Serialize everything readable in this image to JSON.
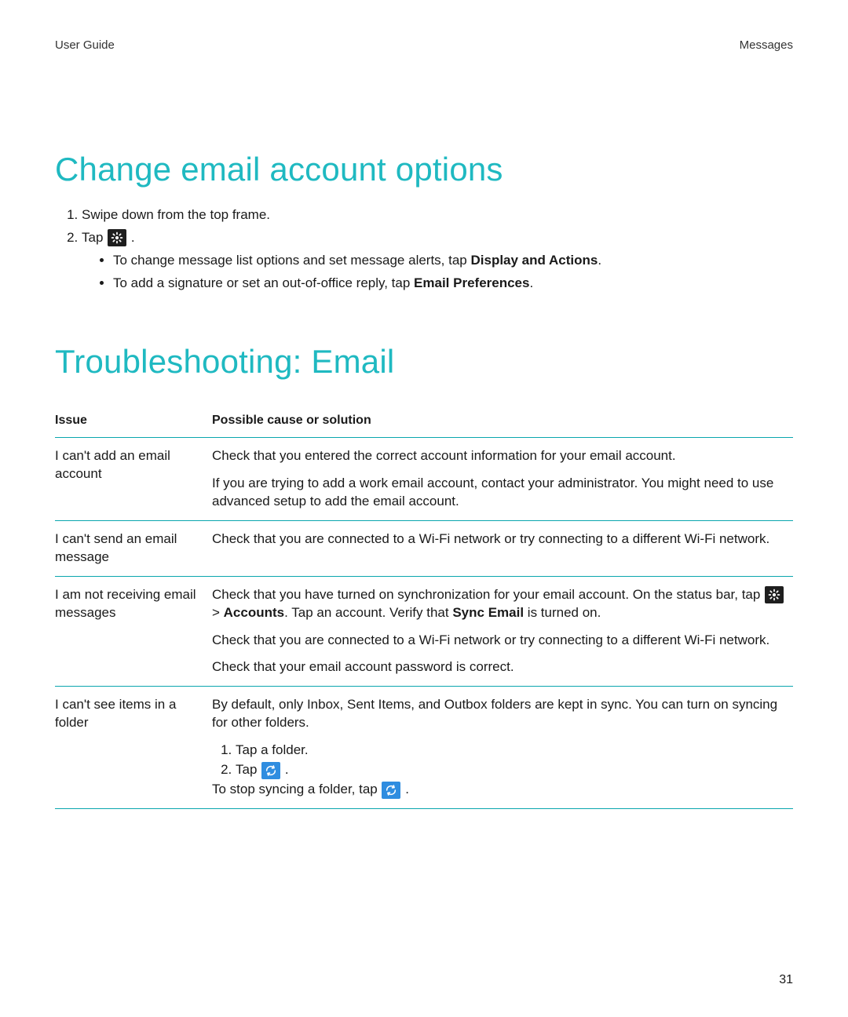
{
  "header": {
    "left": "User Guide",
    "right": "Messages"
  },
  "section1": {
    "title": "Change email account options",
    "steps": {
      "s1": "Swipe down from the top frame.",
      "s2_prefix": "Tap ",
      "s2_suffix": " .",
      "bullets": {
        "b1_pre": "To change message list options and set message alerts, tap ",
        "b1_bold": "Display and Actions",
        "b1_post": ".",
        "b2_pre": "To add a signature or set an out-of-office reply, tap ",
        "b2_bold": "Email Preferences",
        "b2_post": "."
      }
    }
  },
  "section2": {
    "title": "Troubleshooting: Email",
    "col_issue": "Issue",
    "col_solution": "Possible cause or solution",
    "rows": {
      "r1": {
        "issue": "I can't add an email account",
        "p1": "Check that you entered the correct account information for your email account.",
        "p2": "If you are trying to add a work email account, contact your administrator. You might need to use advanced setup to add the email account."
      },
      "r2": {
        "issue": "I can't send an email message",
        "p1": "Check that you are connected to a Wi-Fi network or try connecting to a different Wi-Fi network."
      },
      "r3": {
        "issue": "I am not receiving email messages",
        "p1_pre": "Check that you have turned on synchronization for your email account. On the status bar, tap ",
        "p1_mid1": " > ",
        "p1_bold1": "Accounts",
        "p1_mid2": ". Tap an account. Verify that ",
        "p1_bold2": "Sync Email",
        "p1_post": " is turned on.",
        "p2": "Check that you are connected to a Wi-Fi network or try connecting to a different Wi-Fi network.",
        "p3": "Check that your email account password is correct."
      },
      "r4": {
        "issue": "I can't see items in a folder",
        "p1": "By default, only Inbox, Sent Items, and Outbox folders are kept in sync. You can turn on syncing for other folders.",
        "step1": "Tap a folder.",
        "step2_prefix": "Tap ",
        "step2_suffix": " .",
        "p_last_pre": "To stop syncing a folder, tap ",
        "p_last_post": " ."
      }
    }
  },
  "page_number": "31"
}
